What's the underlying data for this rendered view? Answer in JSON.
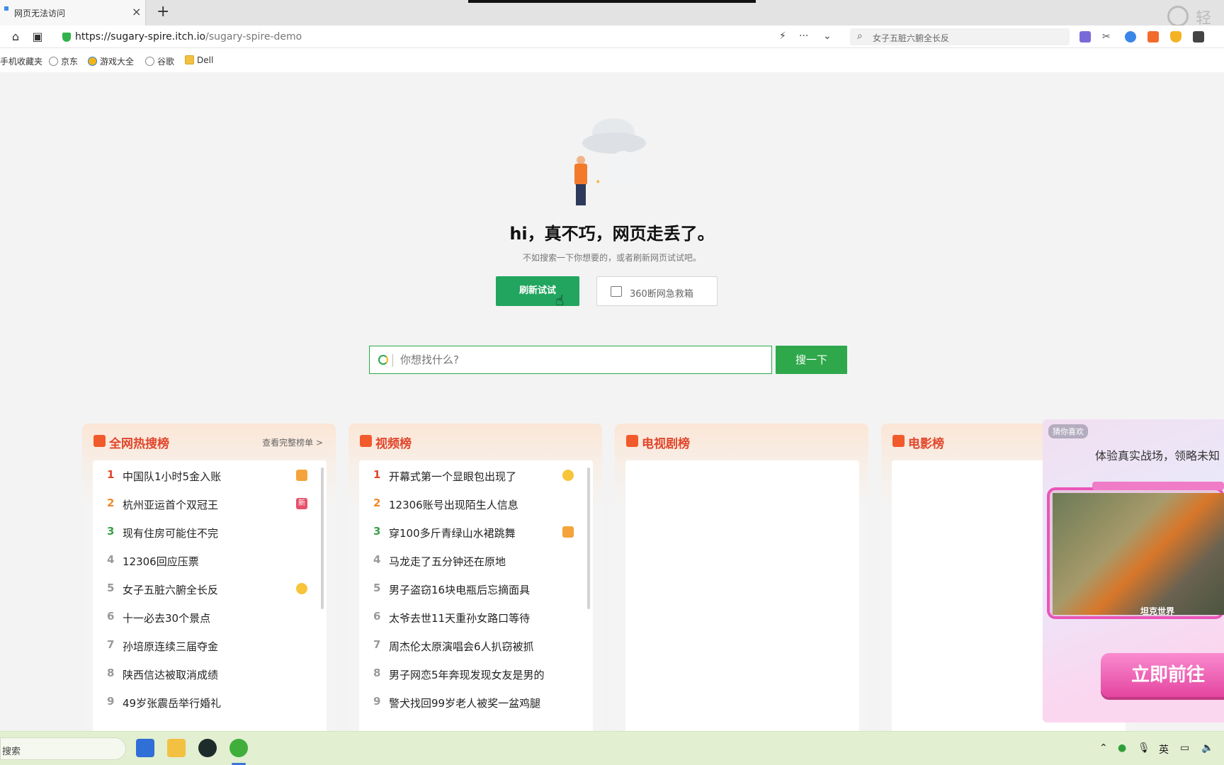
{
  "browser": {
    "tab": {
      "title": "网页无法访问",
      "close": "×"
    },
    "new_tab": "+",
    "url_domain": "https://sugary-spire.itch.io",
    "url_path": "/sugary-spire-demo",
    "search_box_text": "女子五脏六腑全长反",
    "corner_text": "轻吐",
    "bookmarks": [
      {
        "label": "手机收藏夹",
        "icon": "none"
      },
      {
        "label": "京东",
        "icon": "globe"
      },
      {
        "label": "游戏大全",
        "icon": "game"
      },
      {
        "label": "谷歌",
        "icon": "globe"
      },
      {
        "label": "Dell",
        "icon": "folder"
      }
    ]
  },
  "error_page": {
    "headline": "hi，真不巧，网页走丢了。",
    "subline": "不如搜索一下你想要的，或者刷新网页试试吧。",
    "refresh_button": "刷新试试",
    "rescue_button": "360断网急救箱",
    "search_placeholder": "你想找什么?",
    "search_button": "搜一下"
  },
  "panels": [
    {
      "title": "全网热搜榜",
      "more": "查看完整榜单 >",
      "icon_color": "#f15a2b",
      "items": [
        {
          "rank": "1",
          "text": "中国队1小时5金入账",
          "badge": "thumb"
        },
        {
          "rank": "2",
          "text": "杭州亚运首个双冠王",
          "badge": "new",
          "badge_text": "新"
        },
        {
          "rank": "3",
          "text": "现有住房可能住不完",
          "badge": ""
        },
        {
          "rank": "4",
          "text": "12306回应压票",
          "badge": ""
        },
        {
          "rank": "5",
          "text": "女子五脏六腑全长反",
          "badge": "emoji"
        },
        {
          "rank": "6",
          "text": "十一必去30个景点",
          "badge": ""
        },
        {
          "rank": "7",
          "text": "孙培原连续三届夺金",
          "badge": ""
        },
        {
          "rank": "8",
          "text": "陕西信达被取消成绩",
          "badge": ""
        },
        {
          "rank": "9",
          "text": "49岁张震岳举行婚礼",
          "badge": ""
        }
      ]
    },
    {
      "title": "视频榜",
      "more": "",
      "icon_color": "#f15a2b",
      "items": [
        {
          "rank": "1",
          "text": "开幕式第一个显眼包出现了",
          "badge": "emoji"
        },
        {
          "rank": "2",
          "text": "12306账号出现陌生人信息",
          "badge": ""
        },
        {
          "rank": "3",
          "text": "穿100多斤青绿山水裙跳舞",
          "badge": "thumb"
        },
        {
          "rank": "4",
          "text": "马龙走了五分钟还在原地",
          "badge": ""
        },
        {
          "rank": "5",
          "text": "男子盗窃16块电瓶后忘摘面具",
          "badge": ""
        },
        {
          "rank": "6",
          "text": "太爷去世11天重孙女路口等待",
          "badge": ""
        },
        {
          "rank": "7",
          "text": "周杰伦太原演唱会6人扒窃被抓",
          "badge": ""
        },
        {
          "rank": "8",
          "text": "男子网恋5年奔现发现女友是男的",
          "badge": ""
        },
        {
          "rank": "9",
          "text": "警犬找回99岁老人被奖一盆鸡腿",
          "badge": ""
        }
      ]
    },
    {
      "title": "电视剧榜",
      "more": "",
      "icon_color": "#f15a2b",
      "items": []
    },
    {
      "title": "电影榜",
      "more": "",
      "icon_color": "#f15a2b",
      "items": []
    }
  ],
  "ad": {
    "label": "猜你喜欢",
    "headline": "体验真实战场，领略未知",
    "tag": "坦克世界",
    "cta": "立即前往"
  },
  "taskbar": {
    "search_label": "搜索",
    "ime": "英"
  }
}
